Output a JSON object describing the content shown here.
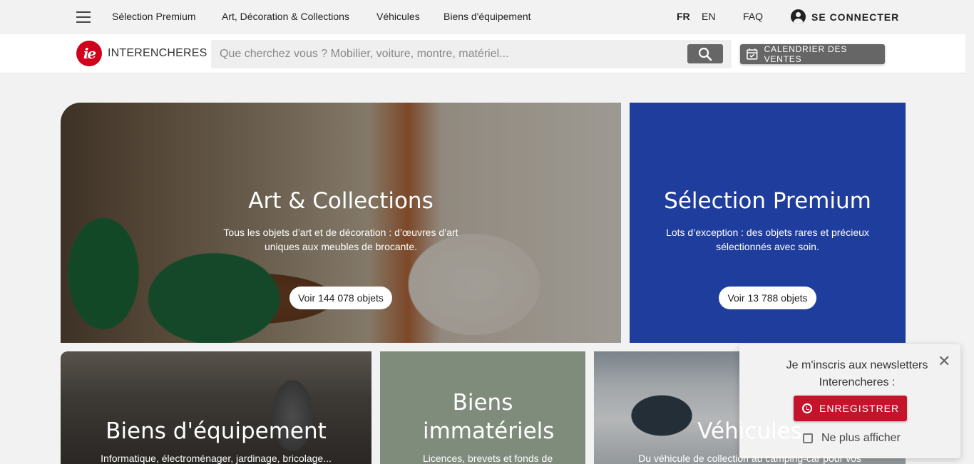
{
  "topbar": {
    "nav": [
      "Sélection Premium",
      "Art, Décoration & Collections",
      "Véhicules",
      "Biens d'équipement"
    ],
    "lang_fr": "FR",
    "lang_en": "EN",
    "faq": "FAQ",
    "login": "SE CONNECTER"
  },
  "header": {
    "logo_mark": "ie",
    "logo_name": "INTERENCHERES",
    "search_placeholder": "Que cherchez vous ? Mobilier, voiture, montre, matériel...",
    "calendar_label": "CALENDRIER DES VENTES"
  },
  "cards": {
    "art": {
      "title": "Art & Collections",
      "desc": "Tous les objets d’art et de décoration : d’œuvres d’art uniques aux meubles de brocante.",
      "cta": "Voir 144 078 objets"
    },
    "premium": {
      "title": "Sélection Premium",
      "desc": "Lots d’exception : des objets rares et précieux sélectionnés avec soin.",
      "cta": "Voir 13 788 objets"
    },
    "equip": {
      "title": "Biens d'équipement",
      "desc": "Informatique, électroménager, jardinage, bricolage..."
    },
    "immat": {
      "title": "Biens immatériels",
      "desc": "Licences, brevets et fonds de"
    },
    "vehic": {
      "title": "Véhicules",
      "desc": "Du véhicule de collection au camping-car pour vos"
    }
  },
  "newsletter": {
    "title": "Je m'inscris aux newsletters Interencheres :",
    "register": "ENREGISTRER",
    "dont_show": "Ne plus afficher"
  },
  "colors": {
    "brand_red": "#d0021b",
    "premium_blue": "#1f3d9c",
    "immat_green": "#7f8c7c",
    "register_red": "#c4142c"
  }
}
